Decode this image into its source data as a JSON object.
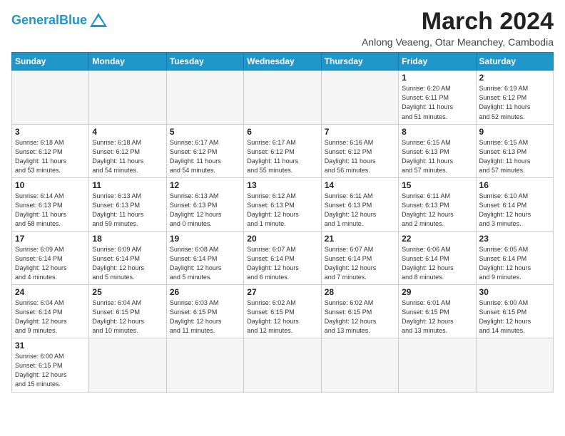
{
  "logo": {
    "text_general": "General",
    "text_blue": "Blue"
  },
  "header": {
    "month": "March 2024",
    "subtitle": "Anlong Veaeng, Otar Meanchey, Cambodia"
  },
  "weekdays": [
    "Sunday",
    "Monday",
    "Tuesday",
    "Wednesday",
    "Thursday",
    "Friday",
    "Saturday"
  ],
  "weeks": [
    [
      {
        "day": "",
        "info": ""
      },
      {
        "day": "",
        "info": ""
      },
      {
        "day": "",
        "info": ""
      },
      {
        "day": "",
        "info": ""
      },
      {
        "day": "",
        "info": ""
      },
      {
        "day": "1",
        "info": "Sunrise: 6:20 AM\nSunset: 6:11 PM\nDaylight: 11 hours\nand 51 minutes."
      },
      {
        "day": "2",
        "info": "Sunrise: 6:19 AM\nSunset: 6:12 PM\nDaylight: 11 hours\nand 52 minutes."
      }
    ],
    [
      {
        "day": "3",
        "info": "Sunrise: 6:18 AM\nSunset: 6:12 PM\nDaylight: 11 hours\nand 53 minutes."
      },
      {
        "day": "4",
        "info": "Sunrise: 6:18 AM\nSunset: 6:12 PM\nDaylight: 11 hours\nand 54 minutes."
      },
      {
        "day": "5",
        "info": "Sunrise: 6:17 AM\nSunset: 6:12 PM\nDaylight: 11 hours\nand 54 minutes."
      },
      {
        "day": "6",
        "info": "Sunrise: 6:17 AM\nSunset: 6:12 PM\nDaylight: 11 hours\nand 55 minutes."
      },
      {
        "day": "7",
        "info": "Sunrise: 6:16 AM\nSunset: 6:12 PM\nDaylight: 11 hours\nand 56 minutes."
      },
      {
        "day": "8",
        "info": "Sunrise: 6:15 AM\nSunset: 6:13 PM\nDaylight: 11 hours\nand 57 minutes."
      },
      {
        "day": "9",
        "info": "Sunrise: 6:15 AM\nSunset: 6:13 PM\nDaylight: 11 hours\nand 57 minutes."
      }
    ],
    [
      {
        "day": "10",
        "info": "Sunrise: 6:14 AM\nSunset: 6:13 PM\nDaylight: 11 hours\nand 58 minutes."
      },
      {
        "day": "11",
        "info": "Sunrise: 6:13 AM\nSunset: 6:13 PM\nDaylight: 11 hours\nand 59 minutes."
      },
      {
        "day": "12",
        "info": "Sunrise: 6:13 AM\nSunset: 6:13 PM\nDaylight: 12 hours\nand 0 minutes."
      },
      {
        "day": "13",
        "info": "Sunrise: 6:12 AM\nSunset: 6:13 PM\nDaylight: 12 hours\nand 1 minute."
      },
      {
        "day": "14",
        "info": "Sunrise: 6:11 AM\nSunset: 6:13 PM\nDaylight: 12 hours\nand 1 minute."
      },
      {
        "day": "15",
        "info": "Sunrise: 6:11 AM\nSunset: 6:13 PM\nDaylight: 12 hours\nand 2 minutes."
      },
      {
        "day": "16",
        "info": "Sunrise: 6:10 AM\nSunset: 6:14 PM\nDaylight: 12 hours\nand 3 minutes."
      }
    ],
    [
      {
        "day": "17",
        "info": "Sunrise: 6:09 AM\nSunset: 6:14 PM\nDaylight: 12 hours\nand 4 minutes."
      },
      {
        "day": "18",
        "info": "Sunrise: 6:09 AM\nSunset: 6:14 PM\nDaylight: 12 hours\nand 5 minutes."
      },
      {
        "day": "19",
        "info": "Sunrise: 6:08 AM\nSunset: 6:14 PM\nDaylight: 12 hours\nand 5 minutes."
      },
      {
        "day": "20",
        "info": "Sunrise: 6:07 AM\nSunset: 6:14 PM\nDaylight: 12 hours\nand 6 minutes."
      },
      {
        "day": "21",
        "info": "Sunrise: 6:07 AM\nSunset: 6:14 PM\nDaylight: 12 hours\nand 7 minutes."
      },
      {
        "day": "22",
        "info": "Sunrise: 6:06 AM\nSunset: 6:14 PM\nDaylight: 12 hours\nand 8 minutes."
      },
      {
        "day": "23",
        "info": "Sunrise: 6:05 AM\nSunset: 6:14 PM\nDaylight: 12 hours\nand 9 minutes."
      }
    ],
    [
      {
        "day": "24",
        "info": "Sunrise: 6:04 AM\nSunset: 6:14 PM\nDaylight: 12 hours\nand 9 minutes."
      },
      {
        "day": "25",
        "info": "Sunrise: 6:04 AM\nSunset: 6:15 PM\nDaylight: 12 hours\nand 10 minutes."
      },
      {
        "day": "26",
        "info": "Sunrise: 6:03 AM\nSunset: 6:15 PM\nDaylight: 12 hours\nand 11 minutes."
      },
      {
        "day": "27",
        "info": "Sunrise: 6:02 AM\nSunset: 6:15 PM\nDaylight: 12 hours\nand 12 minutes."
      },
      {
        "day": "28",
        "info": "Sunrise: 6:02 AM\nSunset: 6:15 PM\nDaylight: 12 hours\nand 13 minutes."
      },
      {
        "day": "29",
        "info": "Sunrise: 6:01 AM\nSunset: 6:15 PM\nDaylight: 12 hours\nand 13 minutes."
      },
      {
        "day": "30",
        "info": "Sunrise: 6:00 AM\nSunset: 6:15 PM\nDaylight: 12 hours\nand 14 minutes."
      }
    ],
    [
      {
        "day": "31",
        "info": "Sunrise: 6:00 AM\nSunset: 6:15 PM\nDaylight: 12 hours\nand 15 minutes."
      },
      {
        "day": "",
        "info": ""
      },
      {
        "day": "",
        "info": ""
      },
      {
        "day": "",
        "info": ""
      },
      {
        "day": "",
        "info": ""
      },
      {
        "day": "",
        "info": ""
      },
      {
        "day": "",
        "info": ""
      }
    ]
  ]
}
